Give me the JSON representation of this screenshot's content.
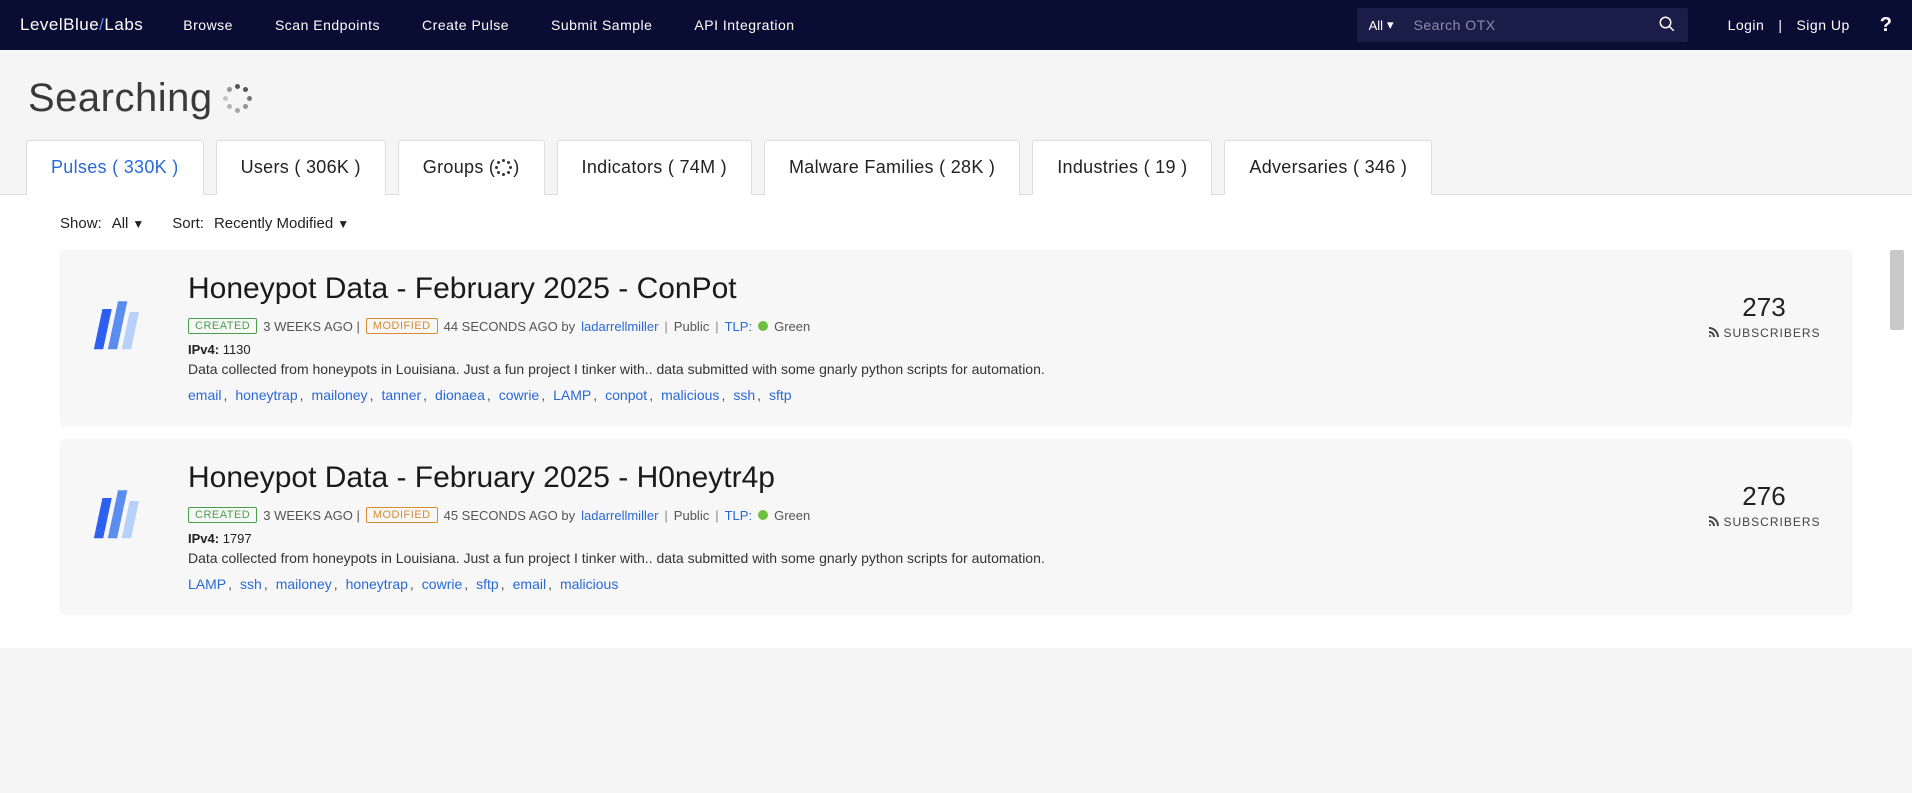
{
  "header": {
    "logo_prefix": "LevelBlue",
    "logo_suffix": "Labs",
    "nav": [
      "Browse",
      "Scan Endpoints",
      "Create Pulse",
      "Submit Sample",
      "API Integration"
    ],
    "search_scope": "All",
    "search_placeholder": "Search OTX",
    "login": "Login",
    "signup": "Sign Up"
  },
  "page_title": "Searching",
  "tabs": [
    {
      "label": "Pulses",
      "count": "330K",
      "active": true
    },
    {
      "label": "Users",
      "count": "306K"
    },
    {
      "label": "Groups",
      "count": null,
      "loading": true
    },
    {
      "label": "Indicators",
      "count": "74M"
    },
    {
      "label": "Malware Families",
      "count": "28K"
    },
    {
      "label": "Industries",
      "count": "19"
    },
    {
      "label": "Adversaries",
      "count": "346"
    }
  ],
  "filters": {
    "show_label": "Show:",
    "show_value": "All",
    "sort_label": "Sort:",
    "sort_value": "Recently Modified"
  },
  "results": [
    {
      "title": "Honeypot Data - February 2025 - ConPot",
      "created_badge": "CREATED",
      "created_ago": "3 WEEKS AGO",
      "modified_badge": "MODIFIED",
      "modified_ago": "44 SECONDS AGO",
      "by": "by",
      "author": "ladarrellmiller",
      "visibility": "Public",
      "tlp_label": "TLP:",
      "tlp_color": "Green",
      "ipv4_label": "IPv4:",
      "ipv4_count": "1130",
      "description": "Data collected from honeypots in Louisiana. Just a fun project I tinker with.. data submitted with some gnarly python scripts for automation.",
      "tags": [
        "email",
        "honeytrap",
        "mailoney",
        "tanner",
        "dionaea",
        "cowrie",
        "LAMP",
        "conpot",
        "malicious",
        "ssh",
        "sftp"
      ],
      "subscribers": "273",
      "subscribers_label": "SUBSCRIBERS"
    },
    {
      "title": "Honeypot Data - February 2025 - H0neytr4p",
      "created_badge": "CREATED",
      "created_ago": "3 WEEKS AGO",
      "modified_badge": "MODIFIED",
      "modified_ago": "45 SECONDS AGO",
      "by": "by",
      "author": "ladarrellmiller",
      "visibility": "Public",
      "tlp_label": "TLP:",
      "tlp_color": "Green",
      "ipv4_label": "IPv4:",
      "ipv4_count": "1797",
      "description": "Data collected from honeypots in Louisiana. Just a fun project I tinker with.. data submitted with some gnarly python scripts for automation.",
      "tags": [
        "LAMP",
        "ssh",
        "mailoney",
        "honeytrap",
        "cowrie",
        "sftp",
        "email",
        "malicious"
      ],
      "subscribers": "276",
      "subscribers_label": "SUBSCRIBERS"
    }
  ]
}
